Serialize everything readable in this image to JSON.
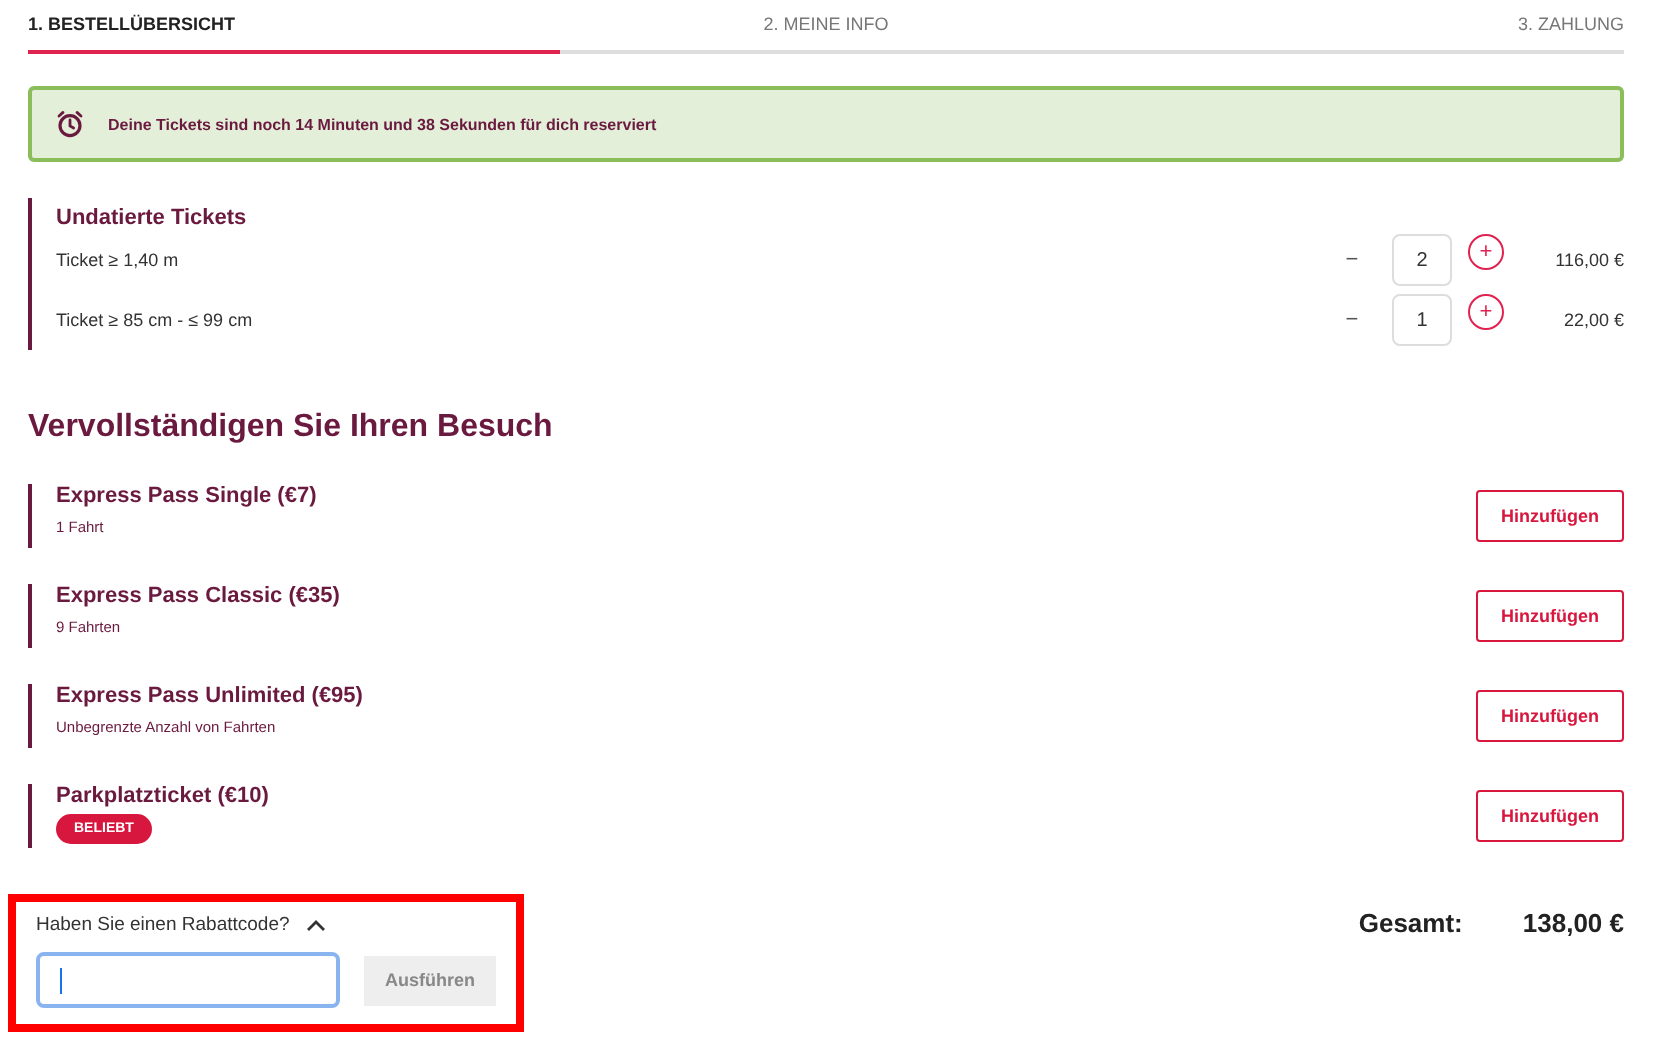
{
  "steps": [
    {
      "label": "1. BESTELLÜBERSICHT",
      "selected": true
    },
    {
      "label": "2. MEINE INFO",
      "selected": false
    },
    {
      "label": "3. ZAHLUNG",
      "selected": false
    }
  ],
  "alert": {
    "text": "Deine Tickets sind noch 14 Minuten und 38 Sekunden für dich reserviert"
  },
  "tickets": {
    "title": "Undatierte Tickets",
    "rows": [
      {
        "name": "Ticket ≥ 1,40 m",
        "minus": "−",
        "quantity": "2",
        "plus": "+",
        "price": "116,00 €"
      },
      {
        "name": "Ticket ≥ 85 cm - ≤ 99 cm",
        "minus": "−",
        "quantity": "1",
        "plus": "+",
        "price": "22,00 €"
      }
    ]
  },
  "extras": {
    "title": "Vervollständigen Sie Ihren Besuch",
    "items": [
      {
        "name": "Express Pass Single (€7)",
        "subtitle": "1 Fahrt",
        "button": "Hinzufügen"
      },
      {
        "name": "Express Pass Classic (€35)",
        "subtitle": "9 Fahrten",
        "button": "Hinzufügen"
      },
      {
        "name": "Express Pass Unlimited (€95)",
        "subtitle": "Unbegrenzte Anzahl von Fahrten",
        "button": "Hinzufügen"
      },
      {
        "name": "Parkplatzticket (€10)",
        "badge": "BELIEBT",
        "button": "Hinzufügen"
      }
    ]
  },
  "discount": {
    "label": "Haben Sie einen Rabattcode?",
    "expanded": true,
    "highlighted": true,
    "apply_button": "Ausführen"
  },
  "total": {
    "label": "Gesamt:",
    "value": "138,00 €"
  }
}
